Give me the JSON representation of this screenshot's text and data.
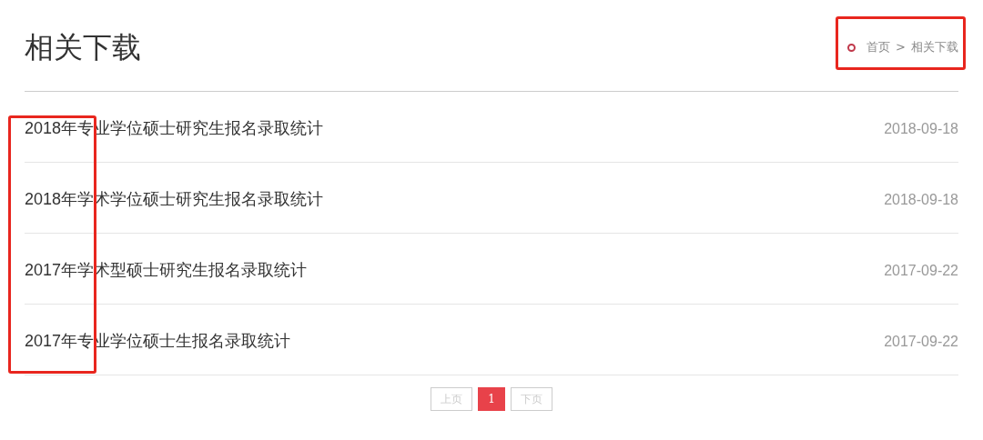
{
  "title": "相关下载",
  "breadcrumb": {
    "items": [
      "首页",
      "相关下载"
    ],
    "separator": ">",
    "boxed": true
  },
  "list": {
    "year_column_boxed": true,
    "items": [
      {
        "title": "2018年专业学位硕士研究生报名录取统计",
        "date": "2018-09-18"
      },
      {
        "title": "2018年学术学位硕士研究生报名录取统计",
        "date": "2018-09-18"
      },
      {
        "title": "2017年学术型硕士研究生报名录取统计",
        "date": "2017-09-22"
      },
      {
        "title": "2017年专业学位硕士生报名录取统计",
        "date": "2017-09-22"
      }
    ]
  },
  "pagination": [
    {
      "label": "上页",
      "selected": false,
      "disabled": true
    },
    {
      "label": "1",
      "selected": true,
      "disabled": false
    },
    {
      "label": "下页",
      "selected": false,
      "disabled": true
    }
  ]
}
